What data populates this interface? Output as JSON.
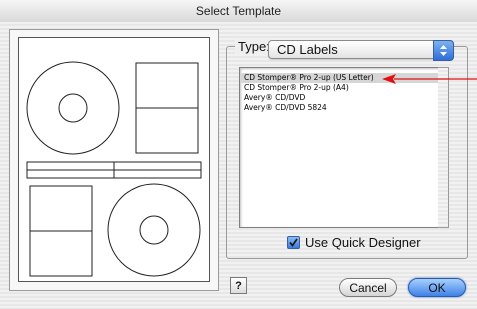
{
  "window": {
    "title": "Select Template"
  },
  "type_selector": {
    "label": "Type:",
    "value": "CD Labels"
  },
  "template_list": {
    "items": [
      {
        "label": "CD Stomper® Pro 2-up (US Letter)",
        "selected": true
      },
      {
        "label": "CD Stomper® Pro 2-up (A4)",
        "selected": false
      },
      {
        "label": "Avery® CD/DVD",
        "selected": false
      },
      {
        "label": "Avery® CD/DVD 5824",
        "selected": false
      }
    ]
  },
  "options": {
    "quick_designer_label": "Use Quick Designer",
    "quick_designer_checked": true
  },
  "buttons": {
    "help": "?",
    "cancel": "Cancel",
    "ok": "OK"
  },
  "colors": {
    "annotation_arrow": "#e01010",
    "accent": "#3f82e6"
  }
}
